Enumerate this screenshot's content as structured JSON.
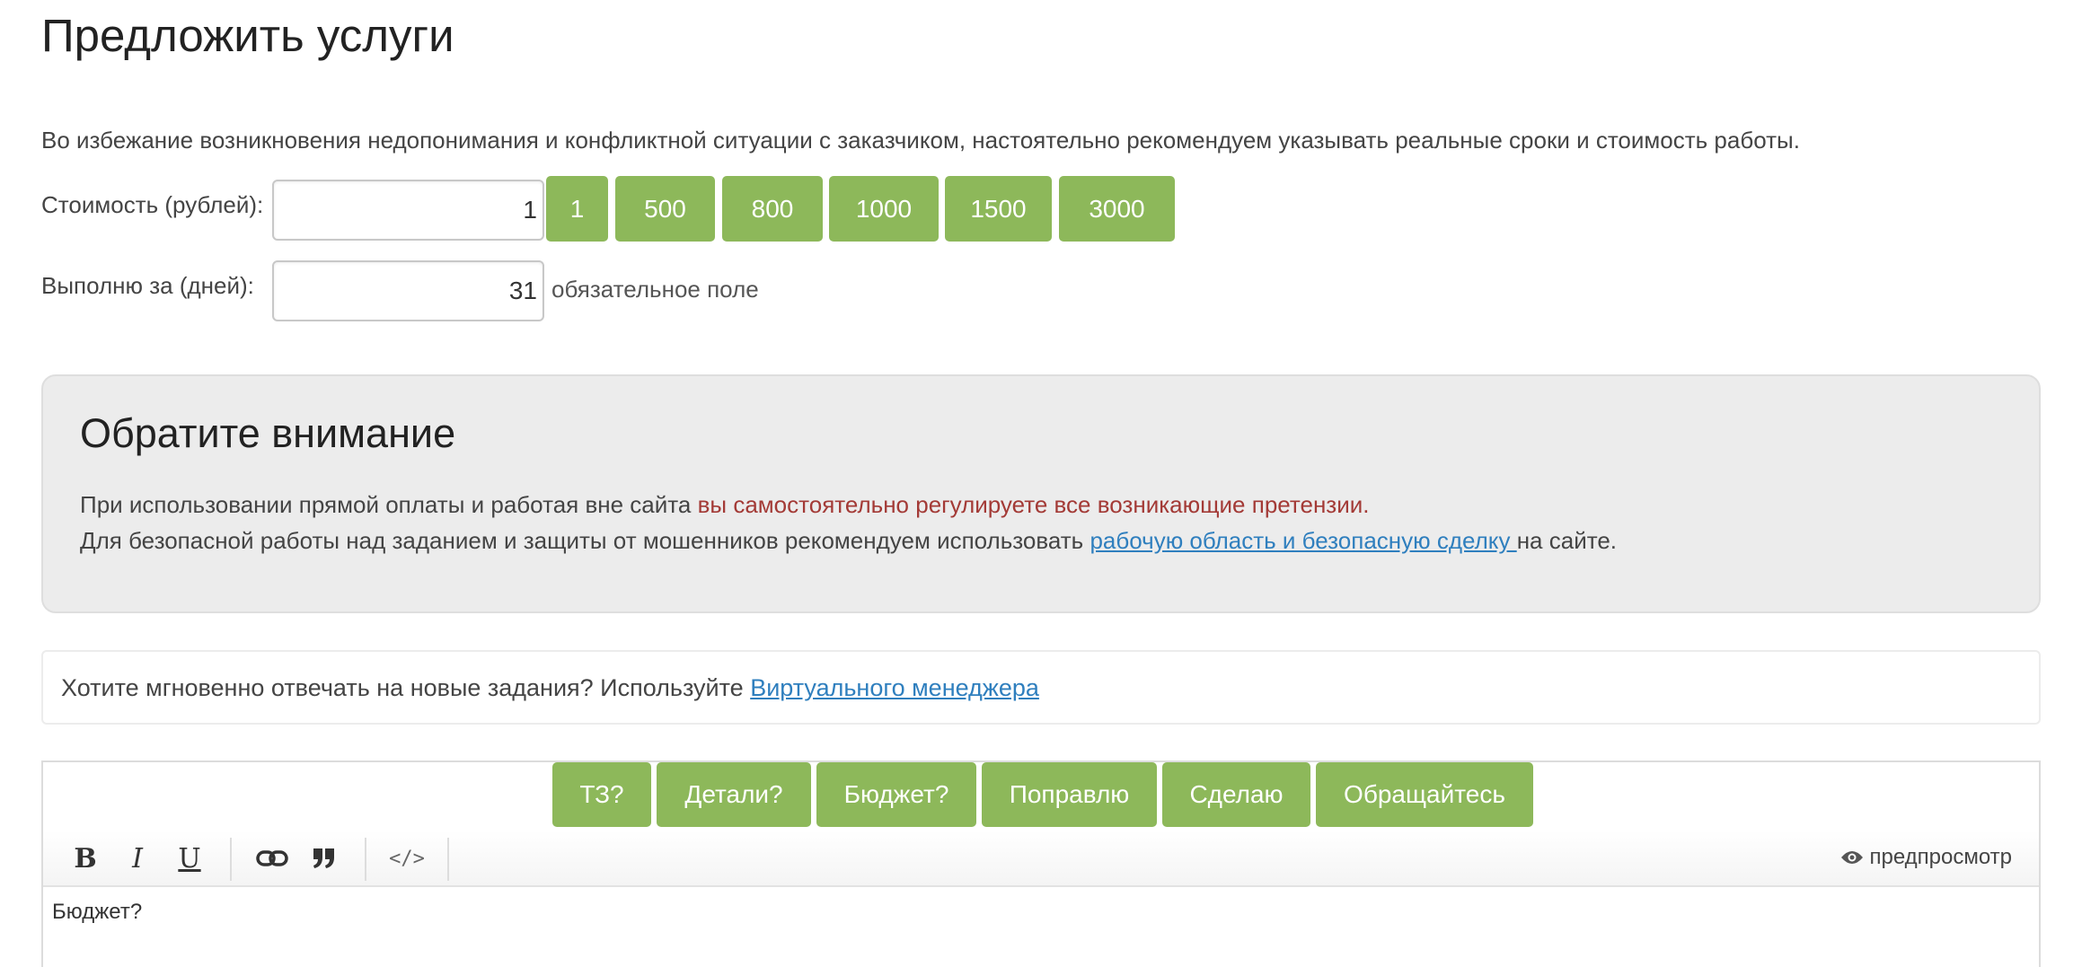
{
  "page": {
    "title": "Предложить услуги"
  },
  "intro": "Во избежание возникновения недопонимания и конфликтной ситуации с заказчиком, настоятельно рекомендуем указывать реальные сроки и стоимость работы.",
  "price": {
    "label": "Стоимость (рублей):",
    "value": "1",
    "quick_values": [
      "1",
      "500",
      "800",
      "1000",
      "1500",
      "3000"
    ]
  },
  "days": {
    "label": "Выполню за (дней):",
    "value": "31",
    "required_note": "обязательное поле"
  },
  "notice": {
    "title": "Обратите внимание",
    "line1_plain": "При использовании прямой оплаты и работая вне сайта ",
    "line1_warning": "вы самостоятельно регулируете все возникающие претензии.",
    "line2_plain": "Для безопасной работы над заданием и защиты от мошенников рекомендуем использовать ",
    "line2_link": "рабочую область и безопасную сделку ",
    "line2_tail": "на сайте.",
    "warning_color": "#a33a36",
    "link_color": "#2f7fbe"
  },
  "virtual_manager": {
    "text": "Хотите мгновенно отвечать на новые задания? Используйте ",
    "link": "Виртуального менеджера"
  },
  "editor": {
    "quick_replies": [
      "ТЗ?",
      "Детали?",
      "Бюджет?",
      "Поправлю",
      "Сделаю",
      "Обращайтесь"
    ],
    "toolbar": {
      "bold_icon": "B",
      "italic_icon": "I",
      "underline_icon": "U",
      "link_icon": "link-icon",
      "quote_icon": "quote-icon",
      "code_icon": "code-icon",
      "preview_label": "предпросмотр",
      "preview_icon": "eye-icon"
    },
    "content": "Бюджет?"
  },
  "colors": {
    "accent_green": "#8db85a",
    "notice_bg": "#ececec"
  }
}
